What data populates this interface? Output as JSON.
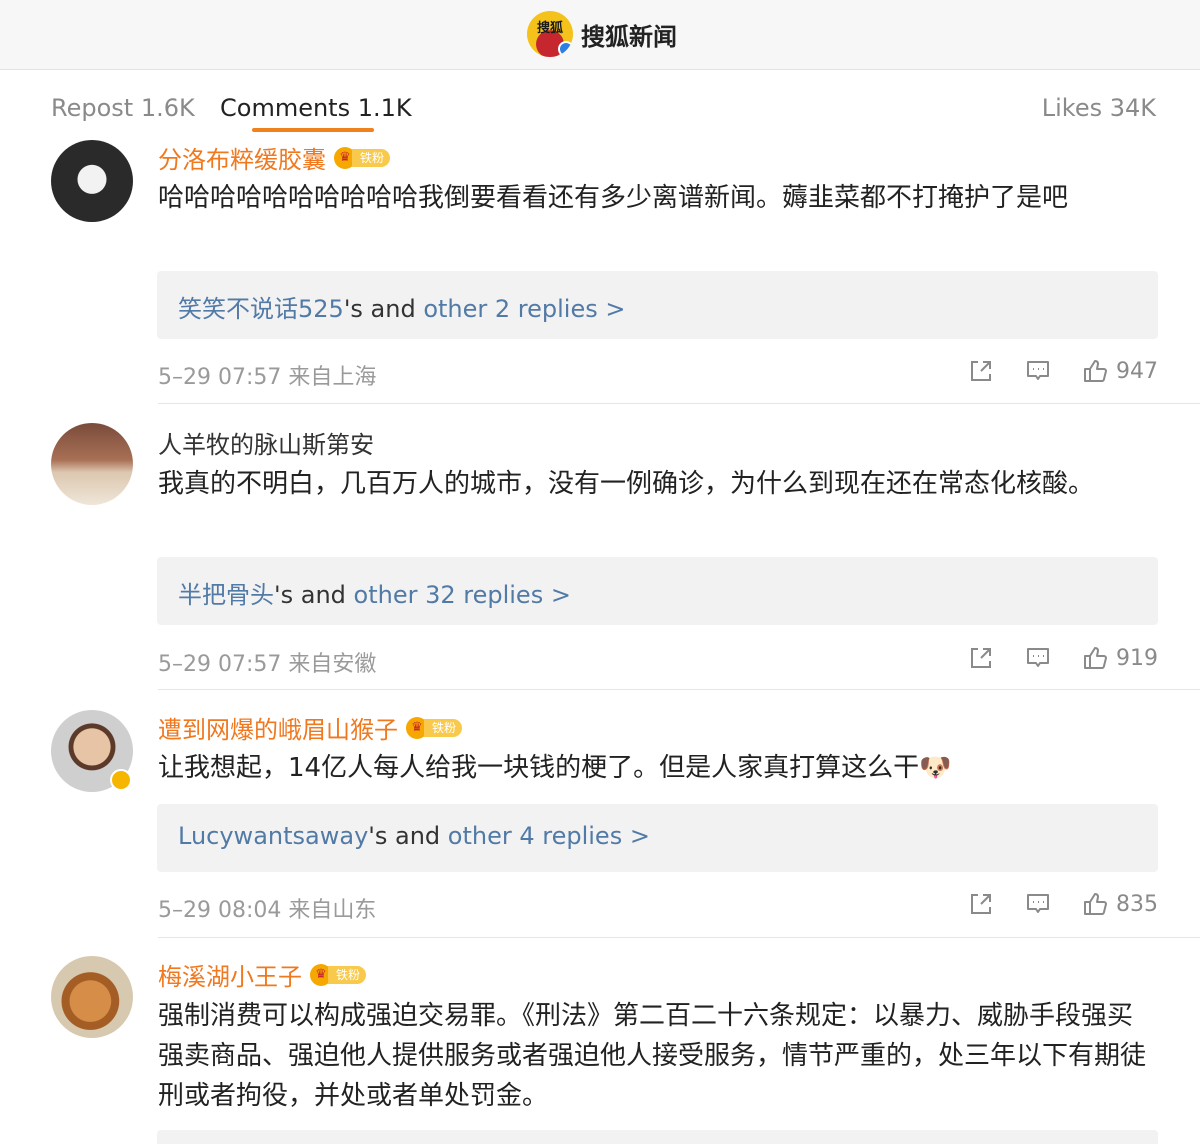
{
  "header": {
    "brand_name": "搜狐新闻",
    "logo_text": "搜狐"
  },
  "tabs": {
    "repost": "Repost 1.6K",
    "comments": "Comments 1.1K",
    "likes": "Likes 34K"
  },
  "fan_badge_label": "铁粉",
  "comments": [
    {
      "username": "分洛布粹缓胶囊",
      "text": "哈哈哈哈哈哈哈哈哈哈我倒要看看还有多少离谱新闻。薅韭菜都不打掩护了是吧",
      "reply_user": "笑笑不说话525",
      "reply_mid": "'s and ",
      "reply_more": "other 2 replies >",
      "timestamp": "5–29 07:57",
      "location": "来自上海",
      "likes": "947"
    },
    {
      "username": "人羊牧的脉山斯第安",
      "text": "我真的不明白，几百万人的城市，没有一例确诊，为什么到现在还在常态化核酸。",
      "reply_user": "半把骨头",
      "reply_mid": "'s and ",
      "reply_more": "other 32 replies >",
      "timestamp": "5–29 07:57",
      "location": "来自安徽",
      "likes": "919"
    },
    {
      "username": "遭到网爆的峨眉山猴子",
      "text": "让我想起，14亿人每人给我一块钱的梗了。但是人家真打算这么干",
      "emoji": "🐶",
      "reply_user": "Lucywantsaway",
      "reply_mid": "'s and ",
      "reply_more": "other 4 replies >",
      "timestamp": "5–29 08:04",
      "location": "来自山东",
      "likes": "835"
    },
    {
      "username": "梅溪湖小王子",
      "text": "强制消费可以构成强迫交易罪。《刑法》第二百二十六条规定：以暴力、威胁手段强买强卖商品、强迫他人提供服务或者强迫他人接受服务，情节严重的，处三年以下有期徒刑或者拘役，并处或者单处罚金。"
    }
  ],
  "icons": {
    "share": "share-icon",
    "comment": "comment-icon",
    "like": "thumbs-up-icon"
  },
  "colors": {
    "accent": "#f0821e",
    "vip_name": "#f0781e",
    "reply_link": "#527aa6"
  }
}
